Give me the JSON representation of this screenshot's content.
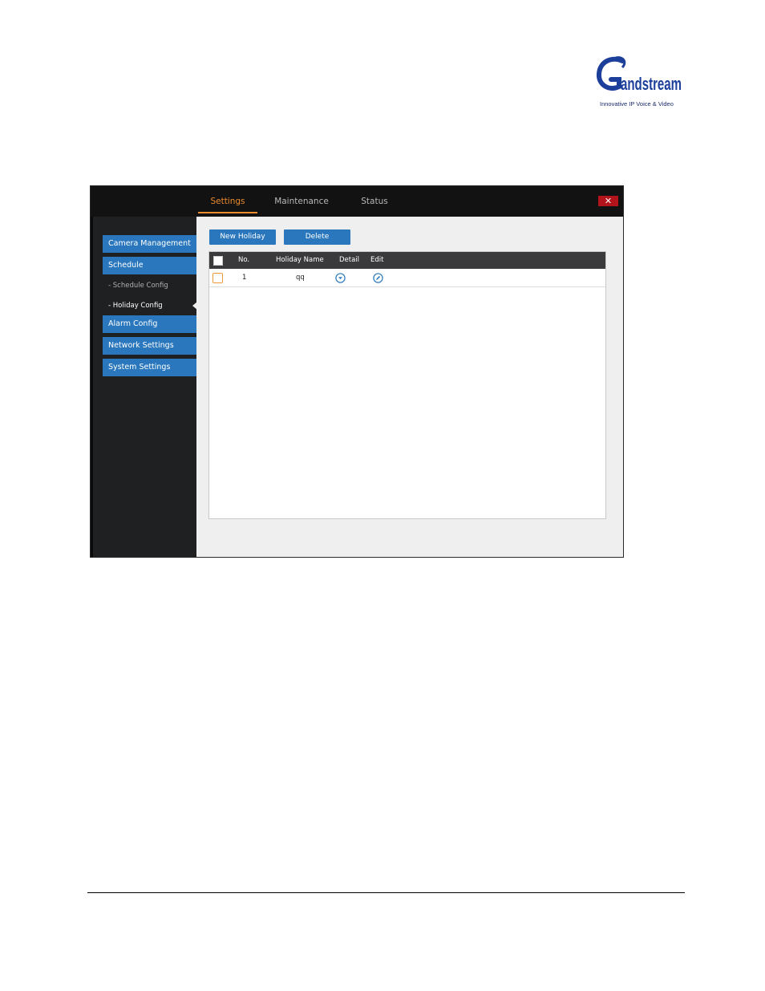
{
  "brand": {
    "tagline": "Innovative IP Voice & Video",
    "colors": {
      "logo_blue": "#1b3f9a",
      "logo_navy": "#1b2b6b"
    }
  },
  "header": {
    "tabs": [
      {
        "label": "Settings",
        "active": true
      },
      {
        "label": "Maintenance",
        "active": false
      },
      {
        "label": "Status",
        "active": false
      }
    ],
    "close_label": "✕",
    "colors": {
      "active_tab": "#ea8a2c",
      "close": "#b3141c"
    }
  },
  "sidebar": {
    "items": [
      {
        "label": "Camera Management",
        "type": "section"
      },
      {
        "label": "Schedule",
        "type": "section"
      },
      {
        "label": "- Schedule Config",
        "type": "sub"
      },
      {
        "label": "- Holiday Config",
        "type": "sub",
        "active": true
      },
      {
        "label": "Alarm Config",
        "type": "section"
      },
      {
        "label": "Network Settings",
        "type": "section"
      },
      {
        "label": "System Settings",
        "type": "section"
      }
    ],
    "colors": {
      "section_bg": "#2a77bd",
      "panel_bg": "#1f2022"
    }
  },
  "toolbar": {
    "new_holiday_label": "New Holiday",
    "delete_label": "Delete"
  },
  "table": {
    "columns": [
      "No.",
      "Holiday Name",
      "Detail",
      "Edit"
    ],
    "rows": [
      {
        "no": "1",
        "holiday_name": "qq",
        "detail_icon": "chevron-down-circle-icon",
        "edit_icon": "pencil-circle-icon"
      }
    ]
  }
}
